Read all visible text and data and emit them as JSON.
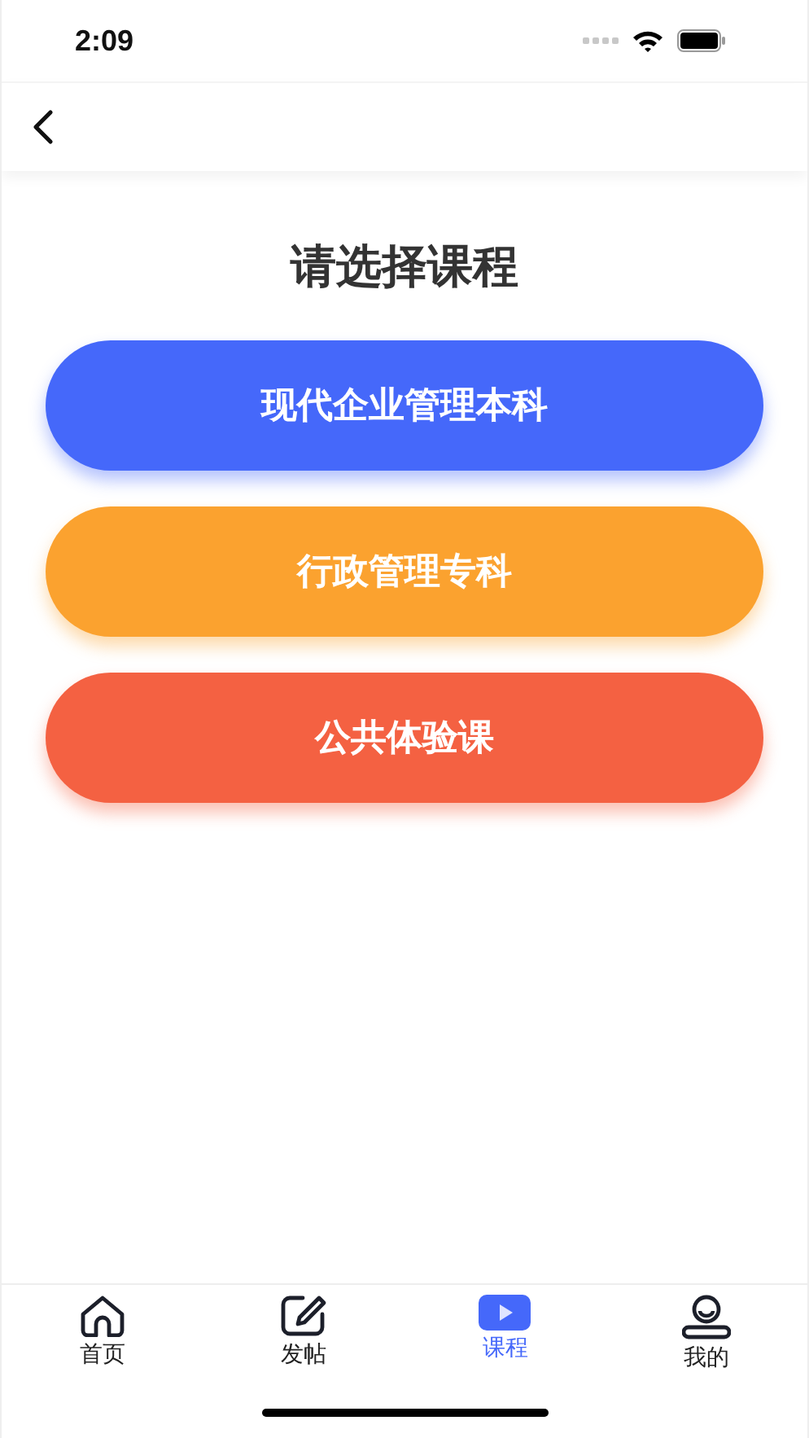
{
  "status_bar": {
    "time": "2:09"
  },
  "title": "请选择课程",
  "courses": [
    {
      "label": "现代企业管理本科",
      "color": "#4568fa"
    },
    {
      "label": "行政管理专科",
      "color": "#fba22f"
    },
    {
      "label": "公共体验课",
      "color": "#f46142"
    }
  ],
  "tabs": [
    {
      "label": "首页",
      "kind": "home",
      "selected": false
    },
    {
      "label": "发帖",
      "kind": "post",
      "selected": false
    },
    {
      "label": "课程",
      "kind": "video",
      "selected": true
    },
    {
      "label": "我的",
      "kind": "profile",
      "selected": false
    }
  ]
}
